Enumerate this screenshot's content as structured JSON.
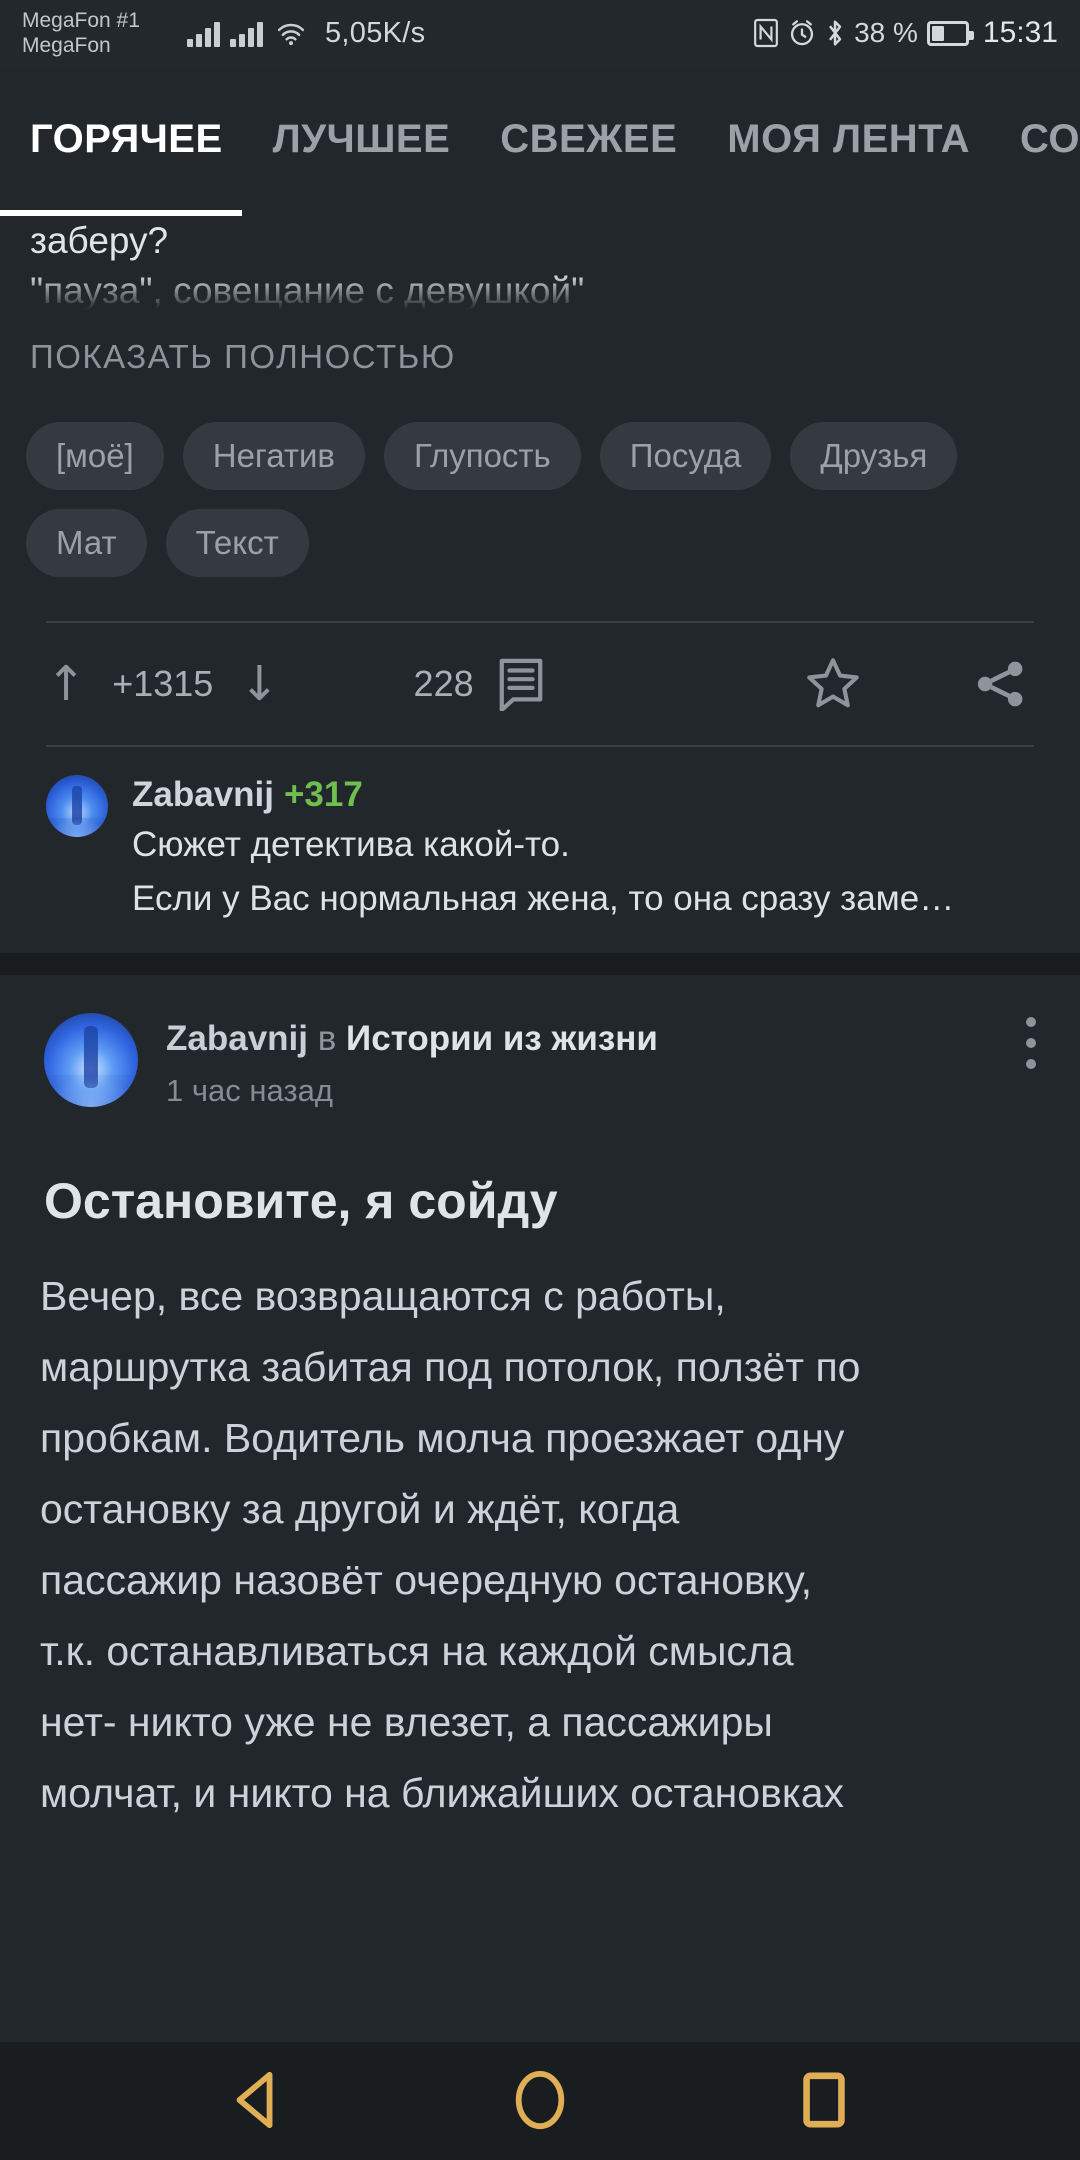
{
  "statusbar": {
    "carrier_line1": "MegaFon #1",
    "carrier_line2": "MegaFon",
    "network_speed": "5,05K/s",
    "nfc_icon": "nfc-icon",
    "alarm_icon": "alarm-icon",
    "bluetooth_icon": "bluetooth-icon",
    "battery_percent": "38 %",
    "clock": "15:31"
  },
  "tabs": [
    {
      "label": "ГОРЯЧЕЕ",
      "active": true
    },
    {
      "label": "ЛУЧШЕЕ",
      "active": false
    },
    {
      "label": "СВЕЖЕЕ",
      "active": false
    },
    {
      "label": "МОЯ ЛЕНТА",
      "active": false
    },
    {
      "label": "СО",
      "active": false
    }
  ],
  "post1": {
    "text_tail_line1": "заберу?",
    "text_tail_line2": "\"пауза\", совещание с девушкой\"",
    "show_more_label": "ПОКАЗАТЬ ПОЛНОСТЬЮ",
    "tags": [
      "[моё]",
      "Негатив",
      "Глупость",
      "Посуда",
      "Друзья",
      "Мат",
      "Текст"
    ],
    "rating": "+1315",
    "upvote_icon": "arrow-up-icon",
    "downvote_icon": "arrow-down-icon",
    "comments_count": "228",
    "comment_icon": "comment-icon",
    "star_icon": "star-icon",
    "share_icon": "share-icon",
    "top_comment": {
      "avatar": "user-avatar",
      "author": "Zabavnij",
      "score": "+317",
      "line1": "Сюжет детектива какой-то.",
      "line2": "Если у Вас нормальная жена, то она сразу заме…"
    }
  },
  "post2": {
    "avatar": "user-avatar",
    "author": "Zabavnij",
    "in_word": "в",
    "community": "Истории из жизни",
    "time_ago": "1 час назад",
    "menu_icon": "kebab-menu-icon",
    "title": "Остановите, я сойду",
    "body_lines": [
      "Вечер, все возвращаются с работы,",
      "маршрутка забитая под потолок, ползёт по",
      "пробкам. Водитель молча проезжает одну",
      "остановку за другой и ждёт, когда",
      "пассажир назовёт очередную остановку,",
      "т.к. останавливаться на каждой смысла",
      "нет- никто уже не влезет, а пассажиры",
      "молчат, и никто на ближайших остановках"
    ]
  },
  "navbar": {
    "back_icon": "back-triangle-icon",
    "home_icon": "home-circle-icon",
    "recents_icon": "recents-square-icon",
    "accent_color": "#e0ae55"
  }
}
